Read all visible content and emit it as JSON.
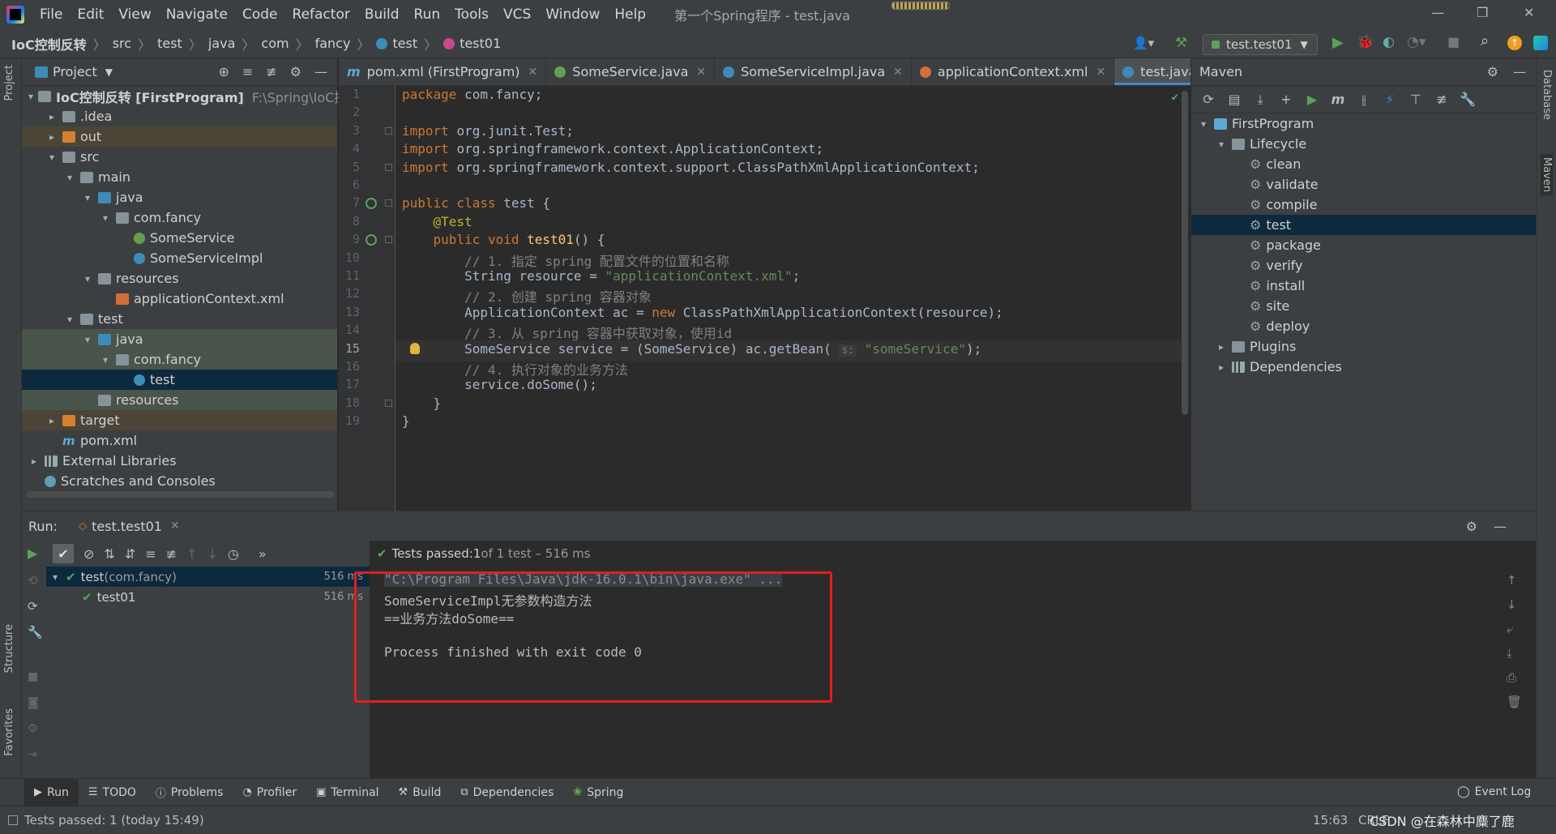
{
  "window": {
    "title": "第一个Spring程序 - test.java",
    "menu": [
      "File",
      "Edit",
      "View",
      "Navigate",
      "Code",
      "Refactor",
      "Build",
      "Run",
      "Tools",
      "VCS",
      "Window",
      "Help"
    ]
  },
  "breadcrumb": [
    "IoC控制反转",
    "src",
    "test",
    "java",
    "com",
    "fancy",
    "test",
    "test01"
  ],
  "run_config": "test.test01",
  "project_panel": {
    "title": "Project",
    "tree": [
      {
        "label": "IoC控制反转 [FirstProgram]",
        "extra": "F:\\Spring\\IoC控制反",
        "depth": 0,
        "arrow": "▾",
        "icon": "folder"
      },
      {
        "label": ".idea",
        "depth": 1,
        "arrow": "▸",
        "icon": "folder"
      },
      {
        "label": "out",
        "depth": 1,
        "arrow": "▸",
        "icon": "folder-o",
        "hl": "brown"
      },
      {
        "label": "src",
        "depth": 1,
        "arrow": "▾",
        "icon": "folder"
      },
      {
        "label": "main",
        "depth": 2,
        "arrow": "▾",
        "icon": "folder"
      },
      {
        "label": "java",
        "depth": 3,
        "arrow": "▾",
        "icon": "folder-b"
      },
      {
        "label": "com.fancy",
        "depth": 4,
        "arrow": "▾",
        "icon": "pkg"
      },
      {
        "label": "SomeService",
        "depth": 5,
        "arrow": "",
        "icon": "iface"
      },
      {
        "label": "SomeServiceImpl",
        "depth": 5,
        "arrow": "",
        "icon": "class"
      },
      {
        "label": "resources",
        "depth": 3,
        "arrow": "▾",
        "icon": "folder"
      },
      {
        "label": "applicationContext.xml",
        "depth": 4,
        "arrow": "",
        "icon": "xml"
      },
      {
        "label": "test",
        "depth": 2,
        "arrow": "▾",
        "icon": "folder"
      },
      {
        "label": "java",
        "depth": 3,
        "arrow": "▾",
        "icon": "folder-g",
        "hl": "green"
      },
      {
        "label": "com.fancy",
        "depth": 4,
        "arrow": "▾",
        "icon": "pkg",
        "hl": "green"
      },
      {
        "label": "test",
        "depth": 5,
        "arrow": "",
        "icon": "class",
        "hl": "sel"
      },
      {
        "label": "resources",
        "depth": 3,
        "arrow": "",
        "icon": "folder",
        "hl": "green"
      },
      {
        "label": "target",
        "depth": 1,
        "arrow": "▸",
        "icon": "folder-o",
        "hl": "brown"
      },
      {
        "label": "pom.xml",
        "depth": 1,
        "arrow": "",
        "icon": "mvn"
      },
      {
        "label": "External Libraries",
        "depth": 0,
        "arrow": "▸",
        "icon": "lib"
      },
      {
        "label": "Scratches and Consoles",
        "depth": 0,
        "arrow": "",
        "icon": "scratch"
      }
    ]
  },
  "editor_tabs": [
    {
      "label": "pom.xml (FirstProgram)",
      "icon": "m",
      "active": false
    },
    {
      "label": "SomeService.java",
      "icon": "iface",
      "active": false
    },
    {
      "label": "SomeServiceImpl.java",
      "icon": "class",
      "active": false
    },
    {
      "label": "applicationContext.xml",
      "icon": "xml",
      "active": false
    },
    {
      "label": "test.java",
      "icon": "class",
      "active": true
    }
  ],
  "code": {
    "current_line": 15,
    "lines": [
      {
        "n": "1",
        "parts": [
          [
            "kw",
            "package "
          ],
          [
            "",
            "com.fancy;"
          ]
        ]
      },
      {
        "n": "2",
        "parts": []
      },
      {
        "n": "3",
        "parts": [
          [
            "kw",
            "import "
          ],
          [
            "",
            "org.junit.Test;"
          ]
        ]
      },
      {
        "n": "4",
        "parts": [
          [
            "kw",
            "import "
          ],
          [
            "",
            "org.springframework.context.ApplicationContext;"
          ]
        ]
      },
      {
        "n": "5",
        "parts": [
          [
            "kw",
            "import "
          ],
          [
            "",
            "org.springframework.context.support.ClassPathXmlApplicationContext;"
          ]
        ]
      },
      {
        "n": "6",
        "parts": []
      },
      {
        "n": "7",
        "parts": [
          [
            "kw",
            "public class "
          ],
          [
            "",
            "test {"
          ]
        ]
      },
      {
        "n": "8",
        "parts": [
          [
            "",
            "    "
          ],
          [
            "ann",
            "@Test"
          ]
        ]
      },
      {
        "n": "9",
        "parts": [
          [
            "",
            "    "
          ],
          [
            "kw",
            "public void "
          ],
          [
            "fn",
            "test01"
          ],
          [
            "",
            "() {"
          ]
        ]
      },
      {
        "n": "10",
        "parts": [
          [
            "",
            "        "
          ],
          [
            "cmt",
            "// 1. 指定 spring 配置文件的位置和名称"
          ]
        ]
      },
      {
        "n": "11",
        "parts": [
          [
            "",
            "        String resource = "
          ],
          [
            "str",
            "\"applicationContext.xml\""
          ],
          [
            "",
            ";"
          ]
        ]
      },
      {
        "n": "12",
        "parts": [
          [
            "",
            "        "
          ],
          [
            "cmt",
            "// 2. 创建 spring 容器对象"
          ]
        ]
      },
      {
        "n": "13",
        "parts": [
          [
            "",
            "        ApplicationContext ac = "
          ],
          [
            "kw",
            "new "
          ],
          [
            "",
            "ClassPathXmlApplicationContext(resource);"
          ]
        ]
      },
      {
        "n": "14",
        "parts": [
          [
            "",
            "        "
          ],
          [
            "cmt",
            "// 3. 从 spring 容器中获取对象，使用id"
          ]
        ]
      },
      {
        "n": "15",
        "parts": [
          [
            "",
            "        SomeService service = (SomeService) ac.getBean( "
          ],
          [
            "hint",
            "s:"
          ],
          [
            "",
            " "
          ],
          [
            "str",
            "\"someService\""
          ],
          [
            "",
            ");"
          ]
        ]
      },
      {
        "n": "16",
        "parts": [
          [
            "",
            "        "
          ],
          [
            "cmt",
            "// 4. 执行对象的业务方法"
          ]
        ]
      },
      {
        "n": "17",
        "parts": [
          [
            "",
            "        service.doSome();"
          ]
        ]
      },
      {
        "n": "18",
        "parts": [
          [
            "",
            "    }"
          ]
        ]
      },
      {
        "n": "19",
        "parts": [
          [
            "",
            "}"
          ]
        ]
      }
    ]
  },
  "maven": {
    "title": "Maven",
    "tree": [
      {
        "label": "FirstProgram",
        "depth": 0,
        "arrow": "▾",
        "icon": "mproj"
      },
      {
        "label": "Lifecycle",
        "depth": 1,
        "arrow": "▾",
        "icon": "mfolder"
      },
      {
        "label": "clean",
        "depth": 2,
        "icon": "gear"
      },
      {
        "label": "validate",
        "depth": 2,
        "icon": "gear"
      },
      {
        "label": "compile",
        "depth": 2,
        "icon": "gear"
      },
      {
        "label": "test",
        "depth": 2,
        "icon": "gear",
        "selected": true
      },
      {
        "label": "package",
        "depth": 2,
        "icon": "gear"
      },
      {
        "label": "verify",
        "depth": 2,
        "icon": "gear"
      },
      {
        "label": "install",
        "depth": 2,
        "icon": "gear"
      },
      {
        "label": "site",
        "depth": 2,
        "icon": "gear"
      },
      {
        "label": "deploy",
        "depth": 2,
        "icon": "gear"
      },
      {
        "label": "Plugins",
        "depth": 1,
        "arrow": "▸",
        "icon": "mfolder"
      },
      {
        "label": "Dependencies",
        "depth": 1,
        "arrow": "▸",
        "icon": "mdeps"
      }
    ]
  },
  "side_tabs": {
    "left_top": "Project",
    "left_mid": "Structure",
    "left_bottom": "Favorites",
    "right_top": "Database",
    "right_mid": "Maven"
  },
  "run_panel": {
    "label": "Run:",
    "tab": "test.test01",
    "status_prefix": "Tests passed: ",
    "status_count": "1",
    "status_suffix": " of 1 test – 516 ms",
    "tests": [
      {
        "name": "test",
        "pkg": " (com.fancy)",
        "time": "516 ms",
        "depth": 0
      },
      {
        "name": "test01",
        "pkg": "",
        "time": "516 ms",
        "depth": 1
      }
    ],
    "console": [
      "\"C:\\Program Files\\Java\\jdk-16.0.1\\bin\\java.exe\" ...",
      "SomeServiceImpl无参数构造方法",
      "==业务方法doSome==",
      "",
      "Process finished with exit code 0"
    ]
  },
  "bottom_tabs": [
    "Run",
    "TODO",
    "Problems",
    "Profiler",
    "Terminal",
    "Build",
    "Dependencies",
    "Spring"
  ],
  "event_log": "Event Log",
  "status": {
    "message": "Tests passed: 1 (today 15:49)",
    "position": "15:63",
    "encoding": "CRLF",
    "watermark": "CSDN @在森林中麋了鹿"
  }
}
